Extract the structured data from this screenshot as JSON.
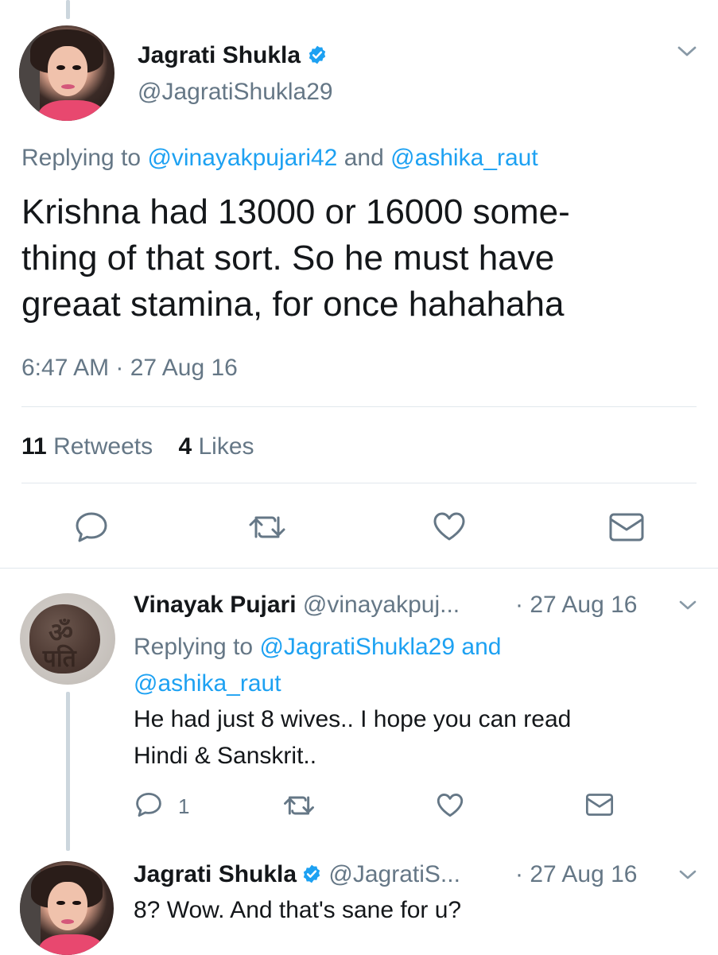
{
  "main_tweet": {
    "author_name": "Jagrati Shukla",
    "author_handle": "@JagratiShukla29",
    "replying_prefix": "Replying to",
    "replying_to_1": "@vinayakpujari42",
    "replying_and": "and",
    "replying_to_2": "@ashika_raut",
    "text_line_1": "Krishna had 13000 or 16000 some-",
    "text_line_2": "thing of that sort. So he must have",
    "text_line_3": "greaat stamina, for once hahahaha",
    "timestamp": "6:47 AM · 27 Aug 16",
    "retweets_count": "11",
    "retweets_label": "Retweets",
    "likes_count": "4",
    "likes_label": "Likes"
  },
  "reply_1": {
    "author_name": "Vinayak Pujari",
    "author_handle": "@vinayakpuj...",
    "date": "· 27 Aug 16",
    "replying_prefix": "Replying to",
    "replying_to_1": "@JagratiShukla29",
    "replying_and": "and",
    "replying_to_2": "@ashika_raut",
    "text_line_1": "He had just 8 wives.. I hope you can read",
    "text_line_2": "Hindi & Sanskrit..",
    "reply_count": "1"
  },
  "reply_2": {
    "author_name": "Jagrati Shukla",
    "author_handle": "@JagratiS...",
    "date": "· 27 Aug 16",
    "text_line_1": "8? Wow. And that's sane for u?"
  },
  "colors": {
    "link": "#1da1f2",
    "secondary_text": "#657786",
    "divider": "#e1e8ed",
    "thread_line": "#ccd6dd",
    "verified": "#1da1f2"
  },
  "icons": [
    "chevron-down-icon",
    "verified-icon",
    "reply-icon",
    "retweet-icon",
    "like-icon",
    "dm-icon"
  ]
}
